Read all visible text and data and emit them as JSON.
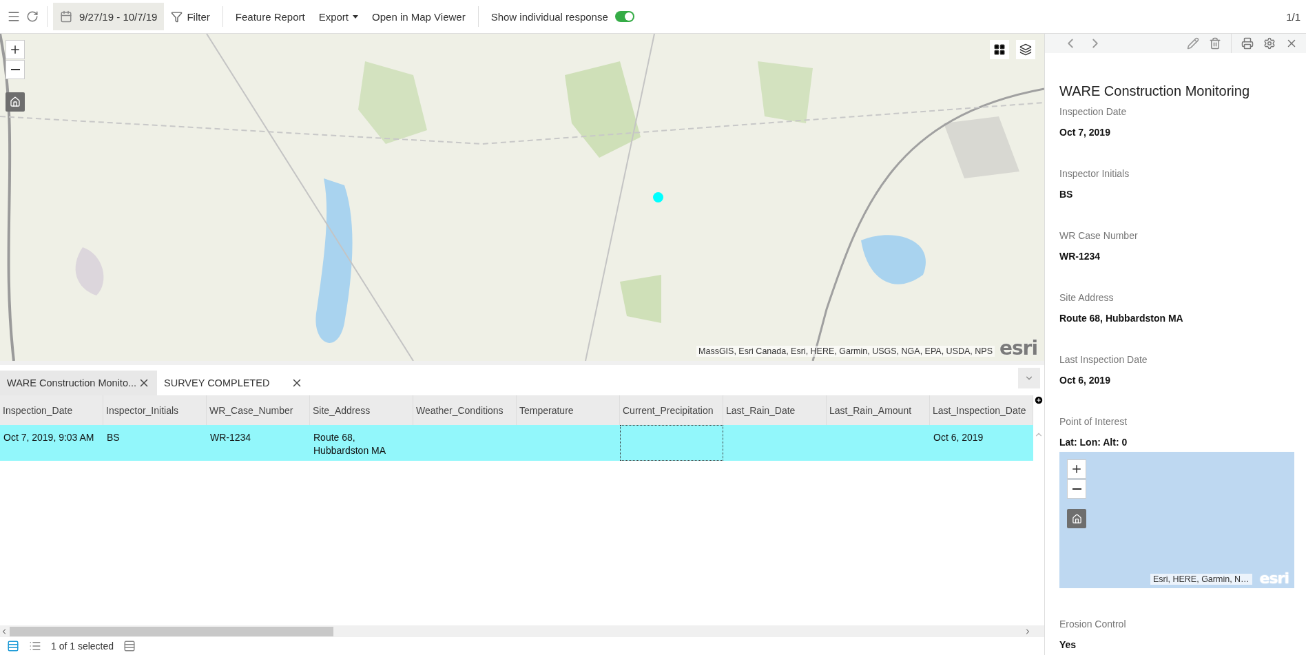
{
  "toolbar": {
    "date_range": "9/27/19 - 10/7/19",
    "filter": "Filter",
    "actions": [
      {
        "label": "Feature Report",
        "kind": "button"
      },
      {
        "label": "Export",
        "kind": "dropdown"
      },
      {
        "label": "Open in Map Viewer",
        "kind": "button"
      }
    ],
    "toggle": {
      "label": "Show individual response",
      "on": true
    },
    "page_counter": "1/1"
  },
  "map": {
    "attribution": "MassGIS, Esri Canada, Esri, HERE, Garmin, USGS, NGA, EPA, USDA, NPS",
    "logo": "esri"
  },
  "table": {
    "tabs": [
      {
        "label": "WARE Construction Monito...",
        "selected": true
      },
      {
        "label": "SURVEY COMPLETED",
        "selected": false
      }
    ],
    "columns": [
      "Inspection_Date",
      "Inspector_Initials",
      "WR_Case_Number",
      "Site_Address",
      "Weather_Conditions",
      "Temperature",
      "Current_Precipitation",
      "Last_Rain_Date",
      "Last_Rain_Amount",
      "Last_Inspection_Date"
    ],
    "rows": [
      {
        "selected": true,
        "cells": [
          {
            "text": "Oct 7, 2019, 9:03 AM",
            "focused": false
          },
          {
            "text": "BS",
            "focused": false
          },
          {
            "text": "WR-1234",
            "focused": false
          },
          {
            "text": "Route 68, Hubbardston MA",
            "focused": false
          },
          {
            "focused": false
          },
          {
            "focused": false
          },
          {
            "focused": true
          },
          {
            "focused": false
          },
          {
            "focused": false
          },
          {
            "text": "Oct 6, 2019",
            "focused": false
          }
        ]
      }
    ]
  },
  "status_bar": {
    "selection": "1 of 1 selected"
  },
  "details": {
    "title": "WARE Construction Monitoring",
    "fields": [
      {
        "kind": "text",
        "label": "Inspection Date",
        "value": "Oct 7, 2019"
      },
      {
        "kind": "text",
        "label": "Inspector Initials",
        "value": "BS"
      },
      {
        "kind": "text",
        "label": "WR Case Number",
        "value": "WR-1234"
      },
      {
        "kind": "text",
        "label": "Site Address",
        "value": "Route 68, Hubbardston MA"
      },
      {
        "kind": "text",
        "label": "Last Inspection Date",
        "value": "Oct 6, 2019"
      },
      {
        "kind": "map",
        "label": "Point of Interest",
        "value": "Lat:  Lon:  Alt: 0",
        "attribution": "Esri, HERE, Garmin, N…",
        "logo": "esri"
      },
      {
        "kind": "text",
        "label": "Erosion Control",
        "value": "Yes"
      }
    ]
  }
}
